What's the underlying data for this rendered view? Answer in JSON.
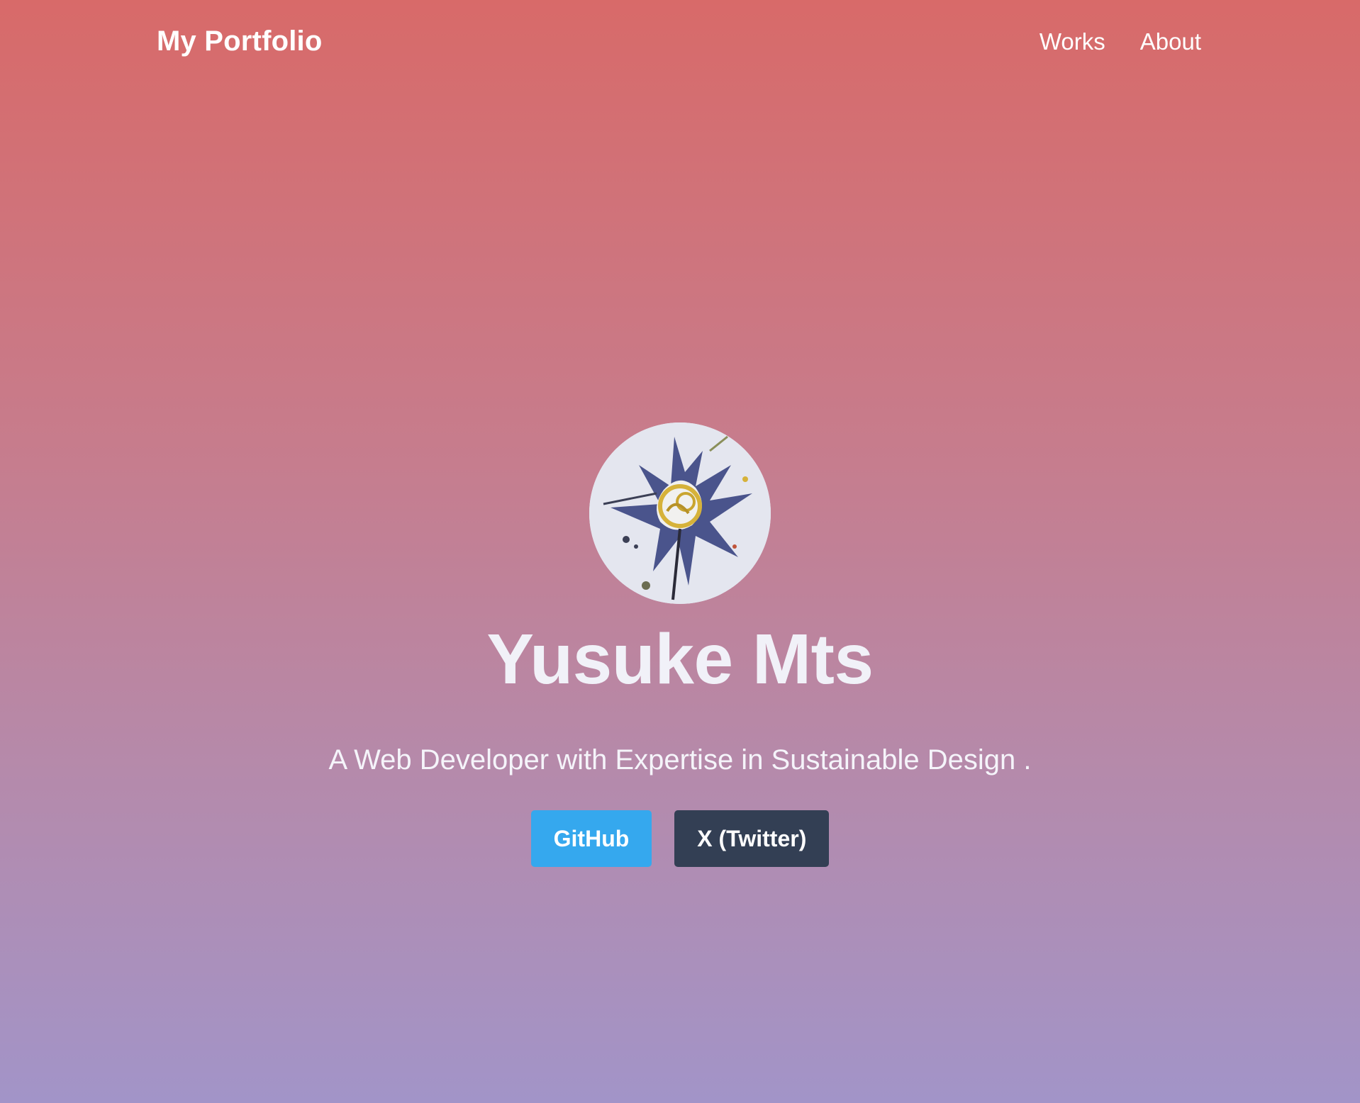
{
  "nav": {
    "brand": "My Portfolio",
    "links": [
      "Works",
      "About"
    ]
  },
  "hero": {
    "avatar_alt": "profile artwork",
    "name": "Yusuke Mts",
    "tagline": "A Web Developer with Expertise in Sustainable Design .",
    "buttons": {
      "github": "GitHub",
      "x": "X (Twitter)"
    }
  },
  "colors": {
    "gradient_top": "#d86a69",
    "gradient_bottom": "#a294c8",
    "github_button": "#35a8ee",
    "x_button": "#333f54"
  }
}
